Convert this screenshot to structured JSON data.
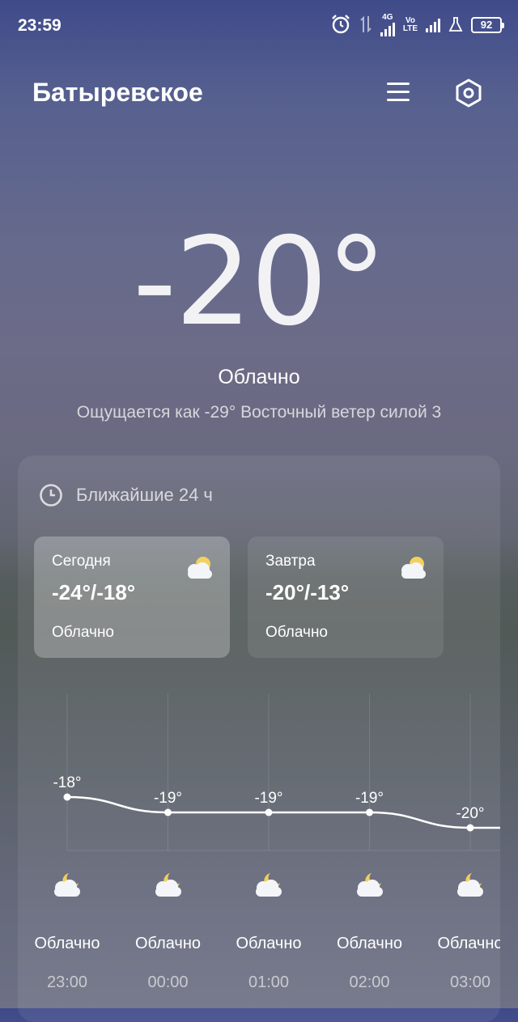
{
  "status_bar": {
    "time": "23:59",
    "icons": [
      "alarm-icon",
      "data-arrows-icon",
      "signal-4g-icon",
      "signal-volte-icon",
      "flask-icon"
    ],
    "net_4g": "4G",
    "net_vo": "Vo",
    "net_lte": "LTE",
    "battery": "92"
  },
  "header": {
    "city": "Батыревское",
    "menu_icon": "menu-icon",
    "settings_icon": "settings-icon"
  },
  "current": {
    "temperature": "-20°",
    "condition": "Облачно",
    "feels_like": "Ощущается как  -29°  Восточный ветер силой 3"
  },
  "forecast_card": {
    "title": "Ближайшие 24 ч",
    "title_icon": "clock-icon",
    "today": {
      "label": "Сегодня",
      "range": "-24°/-18°",
      "condition": "Облачно",
      "icon": "cloudy-sun-icon"
    },
    "tomorrow": {
      "label": "Завтра",
      "range": "-20°/-13°",
      "condition": "Облачно",
      "icon": "cloudy-sun-icon"
    }
  },
  "chart_data": {
    "type": "line",
    "x": [
      "23:00",
      "00:00",
      "01:00",
      "02:00",
      "03:00"
    ],
    "series": [
      {
        "values": [
          -18,
          -19,
          -19,
          -19,
          -20
        ]
      }
    ],
    "labels": [
      "-18°",
      "-19°",
      "-19°",
      "-19°",
      "-20°"
    ]
  },
  "hourly": [
    {
      "time": "23:00",
      "condition": "Облачно",
      "icon": "cloudy-moon-icon"
    },
    {
      "time": "00:00",
      "condition": "Облачно",
      "icon": "cloudy-moon-icon"
    },
    {
      "time": "01:00",
      "condition": "Облачно",
      "icon": "cloudy-moon-icon"
    },
    {
      "time": "02:00",
      "condition": "Облачно",
      "icon": "cloudy-moon-icon"
    },
    {
      "time": "03:00",
      "condition": "Облачно",
      "icon": "cloudy-moon-icon"
    }
  ],
  "colors": {
    "sun": "#f3d060",
    "cloud": "#f4f5f8",
    "moon": "#f0cf5a"
  }
}
